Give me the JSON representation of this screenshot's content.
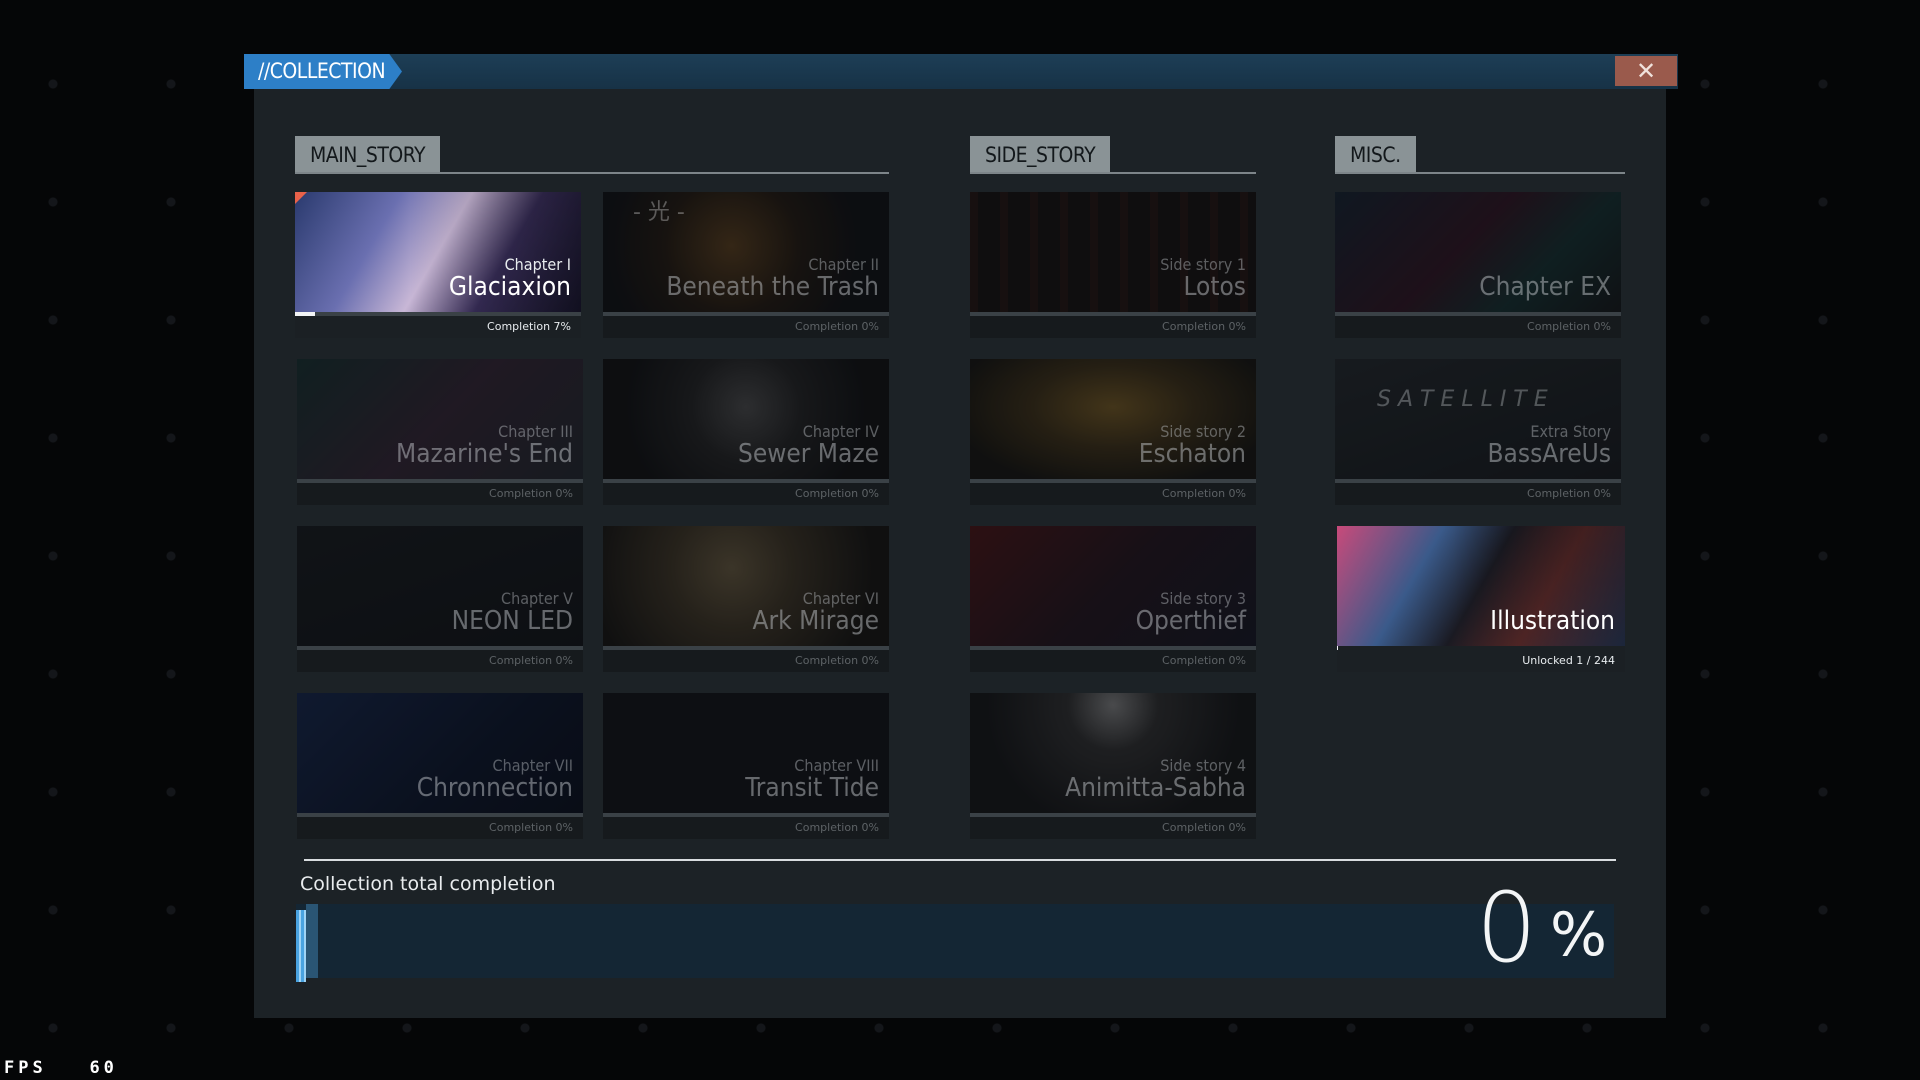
{
  "window": {
    "title": "//COLLECTION",
    "close_glyph": "✕"
  },
  "sections": {
    "main": "MAIN_STORY",
    "side": "SIDE_STORY",
    "misc": "MISC."
  },
  "cards": {
    "ch1": {
      "sub": "Chapter I",
      "name": "Glaciaxion",
      "footer": "Completion 7%",
      "completion": 0.07
    },
    "ch2": {
      "sub": "Chapter II",
      "name": "Beneath the Trash",
      "footer": "Completion 0%",
      "completion": 0
    },
    "ch3": {
      "sub": "Chapter III",
      "name": "Mazarine's End",
      "footer": "Completion 0%",
      "completion": 0
    },
    "ch4": {
      "sub": "Chapter IV",
      "name": "Sewer Maze",
      "footer": "Completion 0%",
      "completion": 0
    },
    "ch5": {
      "sub": "Chapter V",
      "name": "NEON LED",
      "footer": "Completion 0%",
      "completion": 0
    },
    "ch6": {
      "sub": "Chapter VI",
      "name": "Ark Mirage",
      "footer": "Completion 0%",
      "completion": 0
    },
    "ch7": {
      "sub": "Chapter VII",
      "name": "Chronnection",
      "footer": "Completion 0%",
      "completion": 0
    },
    "ch8": {
      "sub": "Chapter VIII",
      "name": "Transit Tide",
      "footer": "Completion 0%",
      "completion": 0
    },
    "ss1": {
      "sub": "Side story 1",
      "name": "Lotos",
      "footer": "Completion 0%",
      "completion": 0
    },
    "ss2": {
      "sub": "Side story 2",
      "name": "Eschaton",
      "footer": "Completion 0%",
      "completion": 0
    },
    "ss3": {
      "sub": "Side story 3",
      "name": "Operthief",
      "footer": "Completion 0%",
      "completion": 0
    },
    "ss4": {
      "sub": "Side story 4",
      "name": "Animitta-Sabha",
      "footer": "Completion 0%",
      "completion": 0
    },
    "ex": {
      "sub": "",
      "name": "Chapter EX",
      "footer": "Completion 0%",
      "completion": 0
    },
    "extra": {
      "sub": "Extra Story",
      "name": "BassAreUs",
      "footer": "Completion 0%",
      "completion": 0
    },
    "illus": {
      "sub": "",
      "name": "Illustration",
      "footer": "Unlocked 1 / 244",
      "completion": 0.004
    }
  },
  "art_text": {
    "ch2": "- 光 -",
    "extra": "S A T E L L I T E"
  },
  "total": {
    "label": "Collection total completion",
    "value": "0",
    "unit": "%",
    "completion": 0
  },
  "fps": {
    "label": "FPS",
    "value": "60"
  },
  "colors": {
    "accent": "#2d7fc7",
    "close": "#9a5a4c",
    "marker": "#e9624a"
  }
}
